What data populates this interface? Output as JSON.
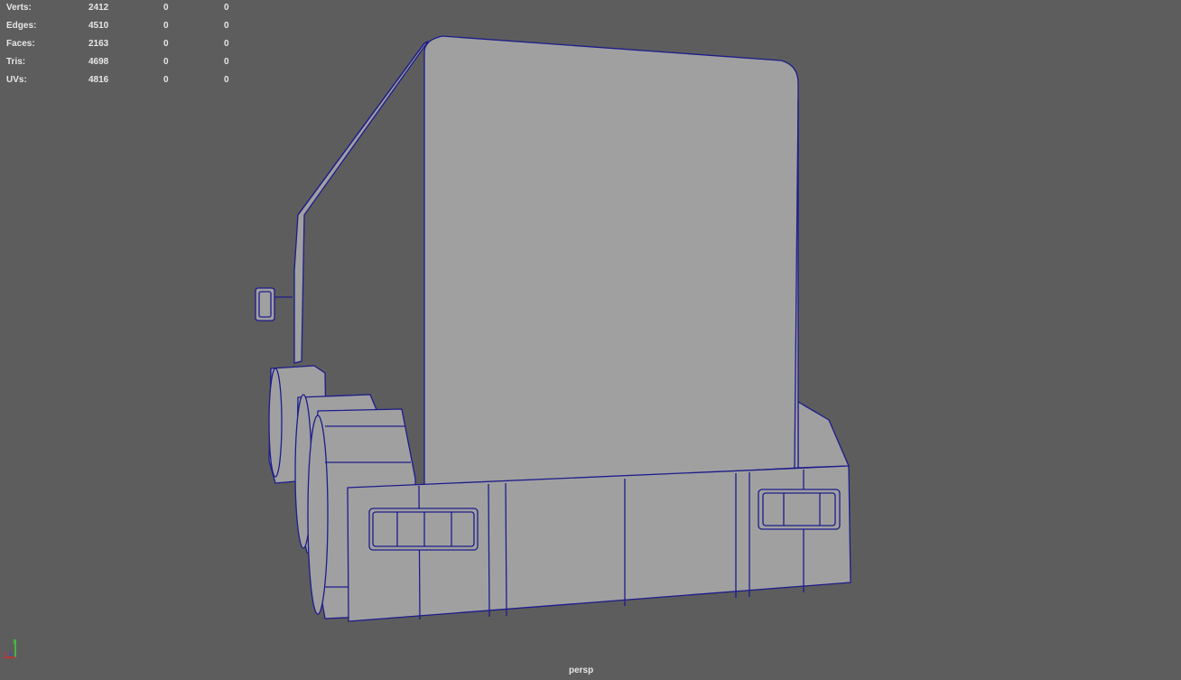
{
  "hud": {
    "rows": [
      {
        "label": "Verts:",
        "total": "2412",
        "selected": "0",
        "extra": "0"
      },
      {
        "label": "Edges:",
        "total": "4510",
        "selected": "0",
        "extra": "0"
      },
      {
        "label": "Faces:",
        "total": "2163",
        "selected": "0",
        "extra": "0"
      },
      {
        "label": "Tris:",
        "total": "4698",
        "selected": "0",
        "extra": "0"
      },
      {
        "label": "UVs:",
        "total": "4816",
        "selected": "0",
        "extra": "0"
      }
    ]
  },
  "camera": {
    "name": "persp"
  },
  "axis": {
    "x": "x",
    "y": "y",
    "z": "z"
  },
  "colors": {
    "background": "#5d5d5d",
    "mesh": "#a0a0a0",
    "wire": "#1c1c8c"
  }
}
